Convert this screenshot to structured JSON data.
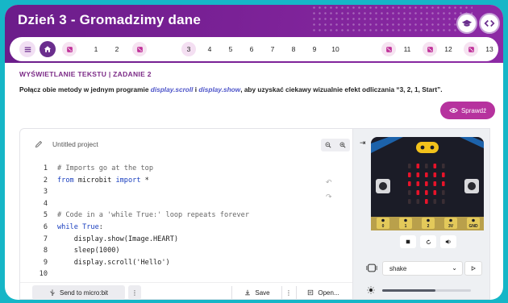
{
  "header": {
    "title": "Dzień 3 - Gromadzimy dane"
  },
  "stepper": {
    "steps": [
      "1",
      "2",
      "3",
      "4",
      "5",
      "6",
      "7",
      "8",
      "9",
      "10",
      "11",
      "12",
      "13"
    ],
    "active_step": "3"
  },
  "task": {
    "title": "WYŚWIETLANIE TEKSTU | ZADANIE 2",
    "desc_before": "Połącz obie metody w jednym programie ",
    "method1": "display.scroll",
    "desc_mid": " i ",
    "method2": "display.show",
    "desc_after": ", aby uzyskać ciekawy wizualnie efekt odliczania “3, 2, 1, Start”.",
    "check_label": "Sprawdź"
  },
  "editor": {
    "project_name": "Untitled project",
    "lines": [
      {
        "num": "1",
        "text": "# Imports go at the top"
      },
      {
        "num": "2",
        "text": "from microbit import *"
      },
      {
        "num": "3",
        "text": ""
      },
      {
        "num": "4",
        "text": ""
      },
      {
        "num": "5",
        "text": "# Code in a 'while True:' loop repeats forever"
      },
      {
        "num": "6",
        "text": "while True:"
      },
      {
        "num": "7",
        "text": "    display.show(Image.HEART)"
      },
      {
        "num": "8",
        "text": "    sleep(1000)"
      },
      {
        "num": "9",
        "text": "    display.scroll('Hello')"
      },
      {
        "num": "10",
        "text": ""
      }
    ],
    "send_label": "Send to micro:bit",
    "save_label": "Save",
    "open_label": "Open..."
  },
  "simulator": {
    "gesture": "shake",
    "pins": [
      "0",
      "1",
      "2",
      "3V",
      "GND"
    ],
    "light_level": 0.6,
    "led_matrix": [
      [
        0,
        1,
        0,
        1,
        0
      ],
      [
        1,
        1,
        1,
        1,
        1
      ],
      [
        1,
        1,
        1,
        1,
        1
      ],
      [
        0,
        1,
        1,
        1,
        0
      ],
      [
        0,
        0,
        1,
        0,
        0
      ]
    ]
  },
  "colors": {
    "header": "#7a2196",
    "accent": "#b6329e",
    "background": "#16b6c7",
    "led_on": "#e8132a"
  }
}
